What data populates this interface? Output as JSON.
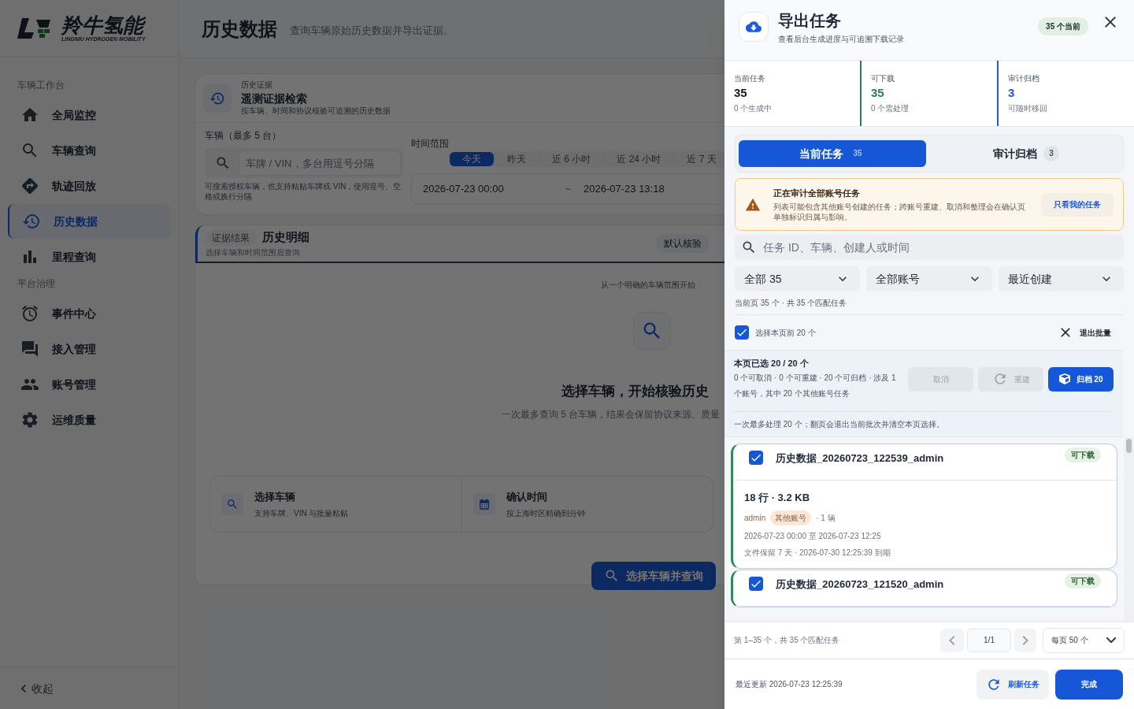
{
  "sidebar": {
    "logo": {
      "name": "羚牛氢能",
      "tagline": "LINGNIU HYDROGEN MOBILITY"
    },
    "groups": [
      {
        "title": "车辆工作台",
        "items": [
          {
            "label": "全局监控",
            "selected": false
          },
          {
            "label": "车辆查询",
            "selected": false
          },
          {
            "label": "轨迹回放",
            "selected": false
          },
          {
            "label": "历史数据",
            "selected": true
          },
          {
            "label": "里程查询",
            "selected": false
          }
        ]
      },
      {
        "title": "平台治理",
        "items": [
          {
            "label": "事件中心",
            "selected": false
          },
          {
            "label": "接入管理",
            "selected": false
          },
          {
            "label": "账号管理",
            "selected": false
          },
          {
            "label": "运维质量",
            "selected": false
          }
        ]
      }
    ],
    "collapse": "收起"
  },
  "page": {
    "title": "历史数据",
    "subtitle": "查询车辆原始历史数据并导出证据。"
  },
  "search_card": {
    "eyebrow": "历史证据",
    "title": "遥测证据检索",
    "subtitle": "按车辆、时间和协议核验可追溯的历史数据",
    "vehicle_label": "车辆（最多 5 台）",
    "vehicle_placeholder": "车牌 / VIN，多台用逗号分隔",
    "vehicle_hint": "可搜索授权车辆，也支持粘贴车牌或 VIN，使用逗号、空格或换行分隔",
    "time_label": "时间范围",
    "presets": [
      {
        "label": "今天",
        "selected": true
      },
      {
        "label": "昨天",
        "selected": false
      },
      {
        "label": "近 6 小时",
        "selected": false
      },
      {
        "label": "近 24 小时",
        "selected": false
      },
      {
        "label": "近 7 天",
        "selected": false
      }
    ],
    "start": "2026-07-23 00:00",
    "separator": "~",
    "end": "2026-07-23 13:18"
  },
  "result_card": {
    "badge": "证据结果",
    "title": "历史明细",
    "subtitle": "选择车辆和时间范围后查询",
    "mode": "默认核验",
    "empty_kicker": "从一个明确的车辆范围开始",
    "empty_title": "选择车辆，开始核验历史",
    "empty_text": "一次最多查询 5 台车辆，结果会保留协议来源、质量",
    "steps": [
      {
        "title": "选择车辆",
        "text": "支持车牌、VIN 与批量粘贴"
      },
      {
        "title": "确认时间",
        "text": "按上海时区精确到分钟"
      }
    ],
    "action": "选择车辆并查询"
  },
  "drawer": {
    "title": "导出任务",
    "subtitle": "查看后台生成进度与可追溯下载记录",
    "badge": "35 个当前",
    "stats": [
      {
        "label": "当前任务",
        "value": "35",
        "note": "0 个生成中",
        "color": "#111827"
      },
      {
        "label": "可下载",
        "value": "35",
        "note": "0 个需处理",
        "color": "#2e7d4f"
      },
      {
        "label": "审计归档",
        "value": "3",
        "note": "可随时移回",
        "color": "#1d5bd8"
      }
    ],
    "tabs": [
      {
        "label": "当前任务",
        "count": "35",
        "selected": true
      },
      {
        "label": "审计归档",
        "count": "3",
        "selected": false
      }
    ],
    "notice": {
      "title": "正在审计全部账号任务",
      "text": "列表可能包含其他账号创建的任务；跨账号重建、取消和整理会在确认页单独标识归属与影响。",
      "action": "只看我的任务"
    },
    "search_placeholder": "任务 ID、车辆、创建人或时间",
    "filters": [
      "全部 35",
      "全部账号",
      "最近创建"
    ],
    "summary": "当前页 35 个 · 共 35 个匹配任务",
    "select_page": {
      "label": "选择本页前 20 个",
      "checked": true
    },
    "exit_batch": "退出批量",
    "batch": {
      "title": "本页已选 20 / 20 个",
      "text": "0 个可取消 · 0 个可重建 · 20 个可归档 · 涉及 1 个账号，其中 20 个其他账号任务",
      "actions": [
        {
          "label": "取消",
          "disabled": true
        },
        {
          "label": "重建",
          "disabled": true
        },
        {
          "label": "归档 20",
          "disabled": false
        }
      ],
      "note": "一次最多处理 20 个；翻页会退出当前批次并清空本页选择。"
    },
    "tasks": [
      {
        "name": "历史数据_20260723_122539_admin",
        "status": "可下载",
        "checked": true,
        "size": "18 行 · 3.2 KB",
        "owner": "admin",
        "owner_tag": "其他账号",
        "vehicles": "· 1 辆",
        "range": "2026-07-23 00:00 至 2026-07-23 12:25",
        "retention": "文件保留 7 天 · 2026-07-30 12:25:39 到期"
      },
      {
        "name": "历史数据_20260723_121520_admin",
        "status": "可下载",
        "checked": true
      }
    ],
    "pager": {
      "summary": "第 1–35 个，共 35 个匹配任务",
      "page": "1/1",
      "per_page": "每页 50 个"
    },
    "footer": {
      "updated": "最近更新 2026-07-23 12:25:39",
      "refresh": "刷新任务",
      "done": "完成"
    }
  }
}
